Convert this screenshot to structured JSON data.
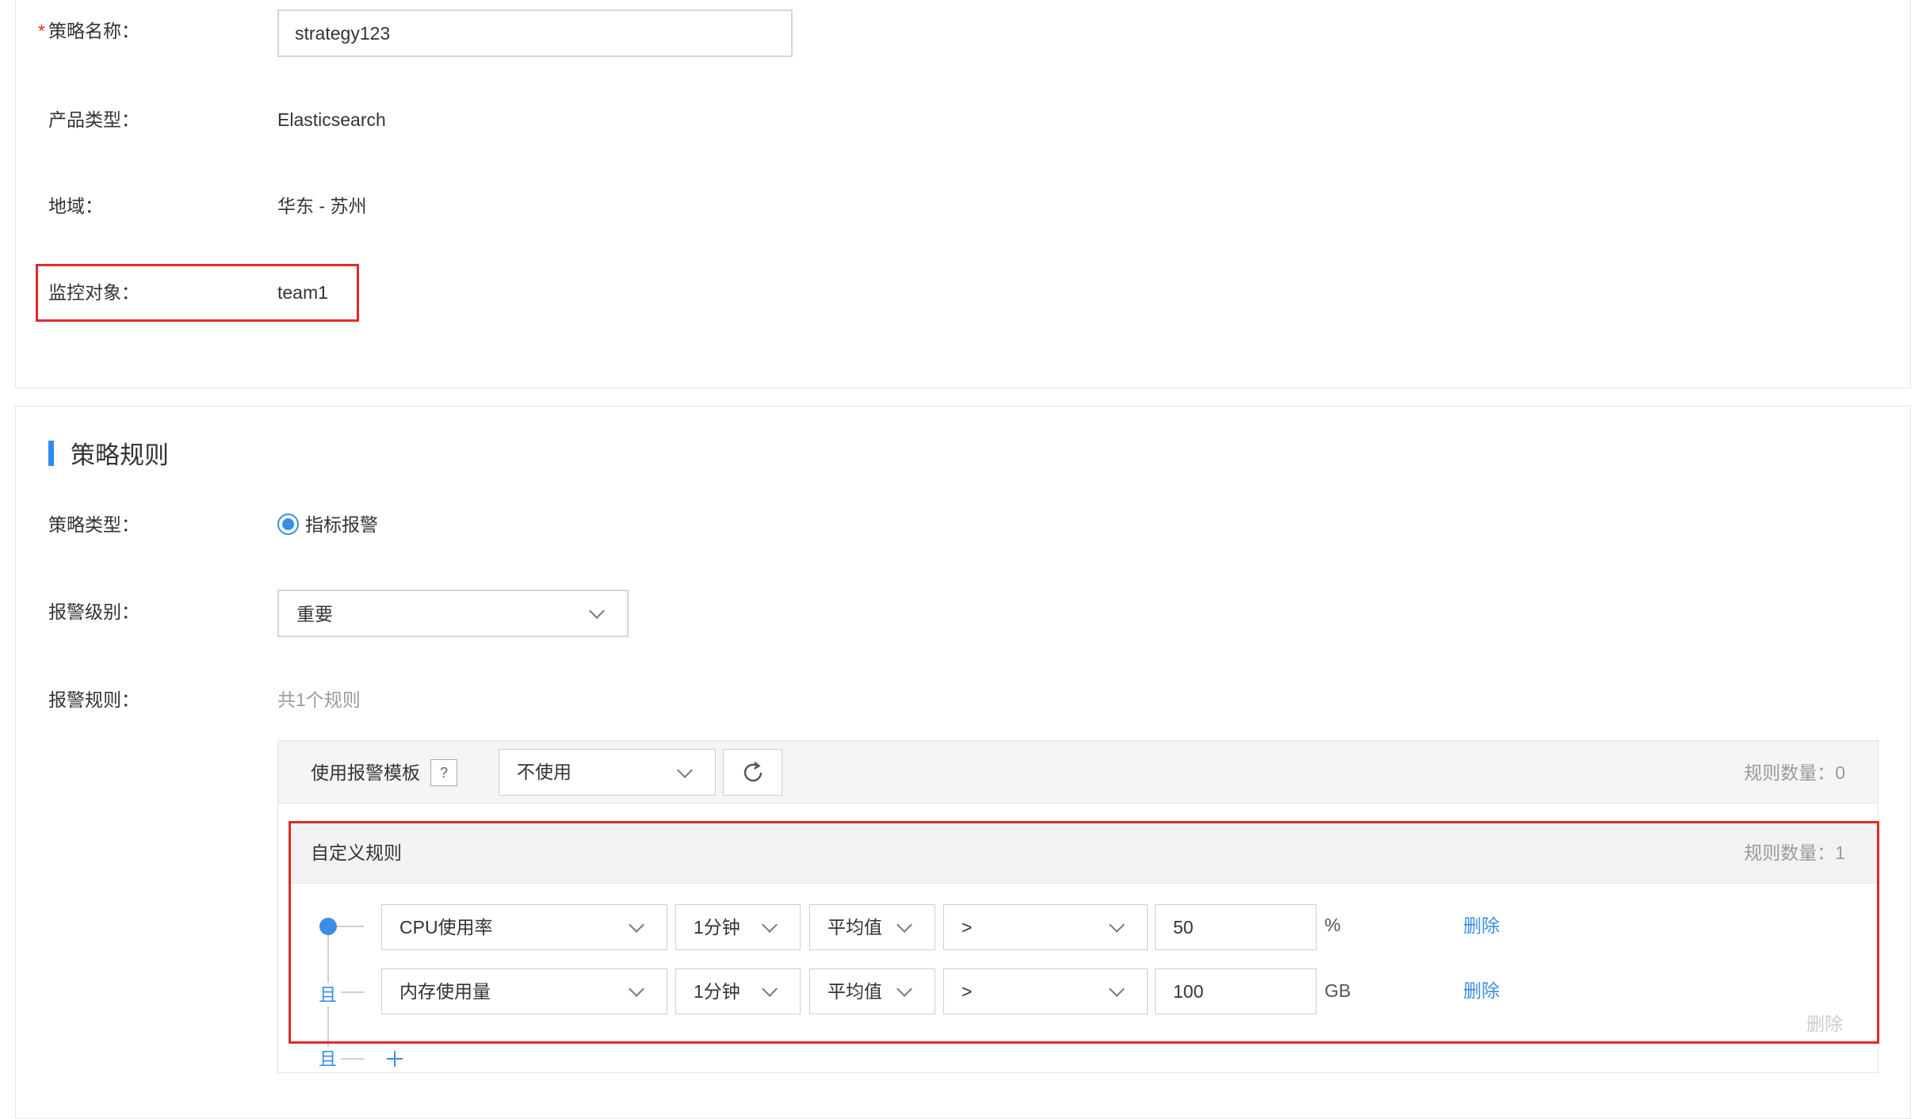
{
  "basic": {
    "required_mark": "*",
    "name_label": "策略名称：",
    "name_value": "strategy123",
    "product_label": "产品类型：",
    "product_value": "Elasticsearch",
    "region_label": "地域：",
    "region_value": "华东 - 苏州",
    "target_label": "监控对象：",
    "target_value": "team1"
  },
  "rules": {
    "section_title": "策略规则",
    "type_label": "策略类型：",
    "type_option": "指标报警",
    "type_selected": true,
    "level_label": "报警级别：",
    "level_value": "重要",
    "alarm_rules_label": "报警规则：",
    "alarm_rules_count": "共1个规则",
    "template": {
      "label": "使用报警模板",
      "help": "?",
      "select_value": "不使用",
      "count": "规则数量：0"
    },
    "custom": {
      "title": "自定义规则",
      "count": "规则数量：1",
      "conditions": [
        {
          "metric": "CPU使用率",
          "period": "1分钟",
          "method": "平均值",
          "operator": ">",
          "threshold": "50",
          "unit": "%",
          "delete": "删除"
        },
        {
          "connector": "且",
          "metric": "内存使用量",
          "period": "1分钟",
          "method": "平均值",
          "operator": ">",
          "threshold": "100",
          "unit": "GB",
          "delete": "删除"
        }
      ],
      "delete_group": "删除",
      "add_connector": "且"
    }
  },
  "icons": [
    "chevron-down-icon",
    "refresh-icon",
    "help-icon",
    "add-icon",
    "radio-checked-icon"
  ],
  "colors": {
    "accent": "#3a8ee6",
    "highlight": "#e02a2a",
    "panel": "#f5f5f5"
  }
}
